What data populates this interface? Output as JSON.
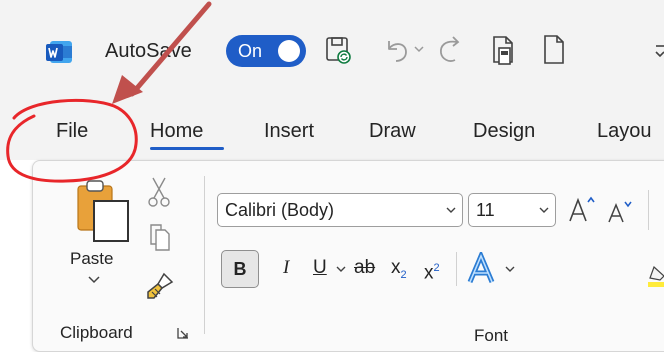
{
  "titlebar": {
    "autosave_label": "AutoSave",
    "autosave_toggle": "On",
    "quick_access": [
      "save-sync-icon",
      "undo-icon",
      "undo-dropdown-icon",
      "redo-icon",
      "page-preview-icon",
      "new-document-icon",
      "customize-icon"
    ]
  },
  "tabs": [
    {
      "label": "File"
    },
    {
      "label": "Home",
      "active": true
    },
    {
      "label": "Insert"
    },
    {
      "label": "Draw"
    },
    {
      "label": "Design"
    },
    {
      "label": "Layou"
    }
  ],
  "clipboard": {
    "paste_label": "Paste",
    "group_label": "Clipboard"
  },
  "font": {
    "font_name": "Calibri (Body)",
    "font_size": "11",
    "group_label": "Font"
  },
  "annotation": {
    "arrow_color": "#c0504d",
    "circle_color": "#e8262a"
  },
  "colors": {
    "accent": "#1f5dc7",
    "word_blue": "#185abd",
    "ribbon_bg": "#fafafa",
    "chrome_bg": "#f3f3f3"
  }
}
